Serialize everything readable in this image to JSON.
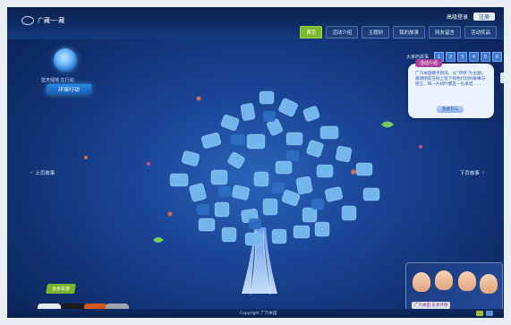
{
  "header": {
    "logo_text": "广藏一·藏",
    "util_text": "高级登录",
    "util_badge": "注册",
    "nav_tabs": [
      {
        "label": "首页"
      },
      {
        "label": "活动介绍"
      },
      {
        "label": "主题树"
      },
      {
        "label": "我的故事"
      },
      {
        "label": "网友留言"
      },
      {
        "label": "活动奖品"
      }
    ]
  },
  "campaign": {
    "title_small": "蓝天绿地 在行动",
    "title_main": "环保行动"
  },
  "nav": {
    "prev_label": "上页故事",
    "next_label": "下页故事"
  },
  "pagination": {
    "label": "大家的故事",
    "pages": [
      "1",
      "2",
      "3",
      "4",
      "5",
      "6"
    ]
  },
  "info_box": {
    "tag": "活动介绍",
    "text": "广汽本田携手新浪，以“环保”为主题，邀请网友在树上留下绿色行动的故事与感言，每一片树叶都是一份承诺……",
    "button_label": "我要参与"
  },
  "promo": {
    "caption": "广汽本田 乐享环保"
  },
  "car_block": {
    "badge_label": "全系车型"
  },
  "footer": {
    "text": "Copyright 广汽本田"
  },
  "colors": {
    "accent_green": "#7bbb2b",
    "background_blue": "#1a4596",
    "info_purple": "#ab3f9b"
  }
}
